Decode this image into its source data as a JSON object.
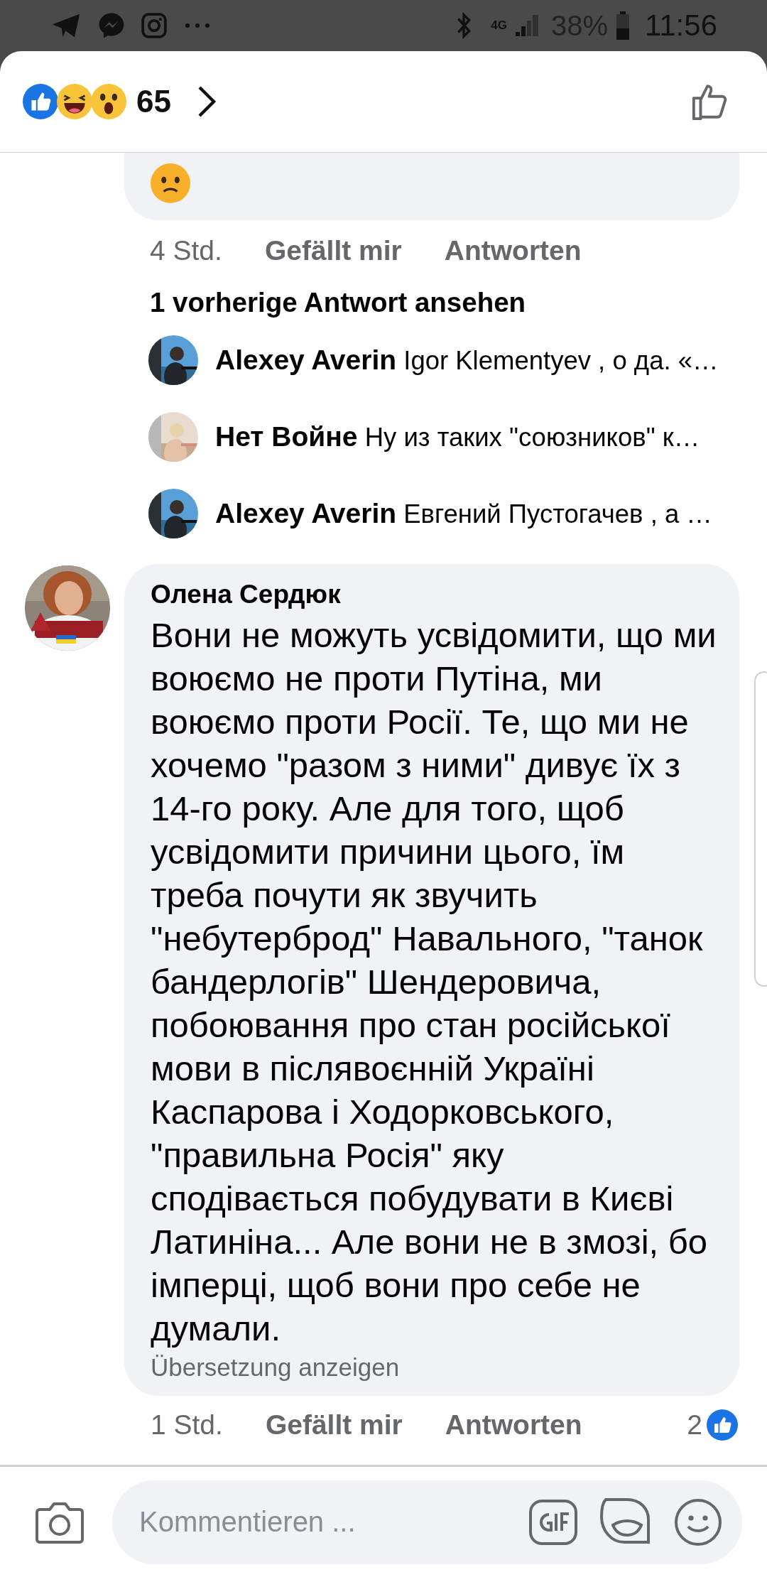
{
  "status_bar": {
    "network": "4G",
    "battery": "38%",
    "time": "11:56"
  },
  "header": {
    "reaction_count": "65"
  },
  "previous_comment": {
    "time": "4 Std.",
    "like": "Gefällt mir",
    "reply": "Antworten"
  },
  "view_previous": "1 vorherige Antwort ansehen",
  "replies": [
    {
      "author": "Alexey Averin",
      "text": "Igor Klementyev , о да. «…"
    },
    {
      "author": "Нет Войне",
      "text": "Ну из таких \"союзников\" к…"
    },
    {
      "author": "Alexey Averin",
      "text": "Евгений Пустогачев , а …"
    }
  ],
  "comment": {
    "author": "Олена Сердюк",
    "text": "Вони не можуть усвідомити, що ми воюємо не проти Путіна, ми воюємо проти Росії. Те, що ми не хочемо \"разом з ними\" дивує їх з 14-го року. Але для того, щоб усвідомити причини цього, їм треба почути як звучить \"небутерброд\" Навального, \"танок бандерлогів\" Шендеровича, побоювання про стан російської мови в післявоєнній Україні Каспарова і Ходорковського, \"правильна Росія\" яку сподівається побудувати в Києві Латиніна... Але вони не в змозі, бо імперці, щоб вони про себе не думали.",
    "translate": "Übersetzung anzeigen",
    "time": "1 Std.",
    "like": "Gefällt mir",
    "reply": "Antworten",
    "like_count": "2"
  },
  "composer": {
    "placeholder": "Kommentieren ..."
  }
}
